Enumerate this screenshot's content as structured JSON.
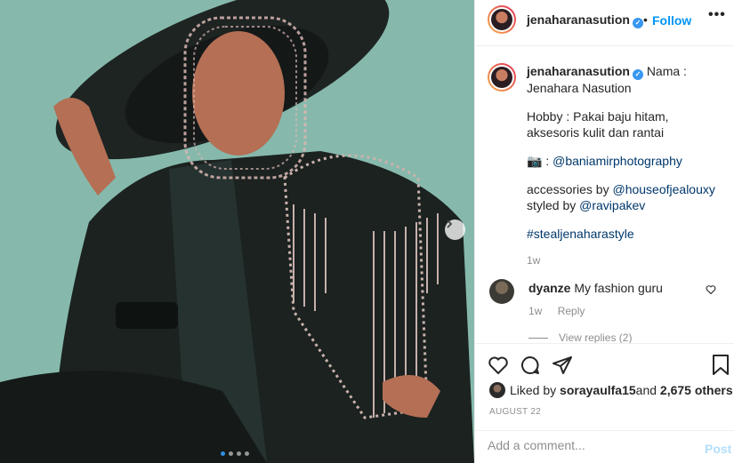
{
  "post": {
    "username": "jenaharanasution",
    "follow_label": "Follow",
    "separator": "•",
    "more_label": "•••"
  },
  "caption": {
    "username": "jenaharanasution",
    "line1": "Nama : Jenahara Nasution",
    "line2": "Hobby : Pakai baju hitam, aksesoris kulit dan rantai",
    "line3_icon": "camera-icon",
    "line3_prefix": "📷 : ",
    "line3_link": "@baniamirphotography",
    "line4_prefix": "accessories by ",
    "line4_link": "@houseofjealouxy",
    "line5_prefix": "styled by ",
    "line5_link": "@ravipakev",
    "hashtag": "#stealjenaharastyle",
    "time": "1w"
  },
  "comment": {
    "username": "dyanze",
    "text": "My fashion guru",
    "time": "1w",
    "reply_label": "Reply",
    "view_replies": "View replies (2)"
  },
  "likes": {
    "prefix": "Liked by ",
    "user": "sorayaulfa15",
    "middle": " and ",
    "others": "2,675 others"
  },
  "date": "AUGUST 22",
  "add_comment": {
    "placeholder": "Add a comment...",
    "post_label": "Post"
  },
  "carousel": {
    "active_index": 0,
    "count": 4
  },
  "colors": {
    "accent": "#0095f6",
    "link": "#00376b",
    "muted": "#8e8e8e",
    "post_disabled": "#b3dffc"
  }
}
